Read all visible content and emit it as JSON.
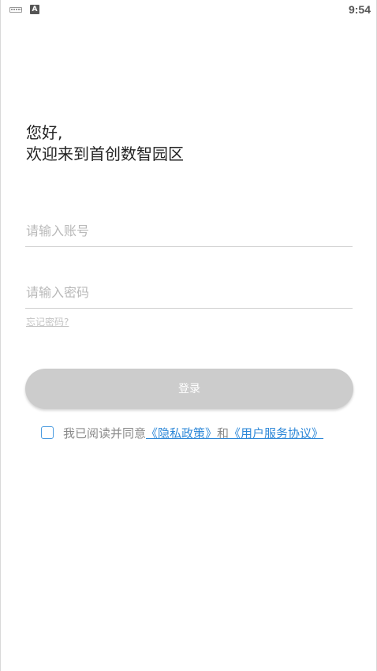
{
  "status_bar": {
    "time": "9:54",
    "a_icon_letter": "A",
    "icons": [
      "keyboard-icon",
      "a-notification-icon"
    ]
  },
  "greeting": {
    "line1": "您好,",
    "line2": "欢迎来到首创数智园区"
  },
  "form": {
    "account_placeholder": "请输入账号",
    "account_value": "",
    "password_placeholder": "请输入密码",
    "password_value": "",
    "forgot_label": "忘记密码?",
    "login_label": "登录"
  },
  "agreement": {
    "checked": false,
    "prefix": "我已阅读并同意",
    "privacy_link": "《隐私政策》",
    "and": "和",
    "terms_link": "《用户服务协议》"
  },
  "colors": {
    "link": "#2e88d8",
    "button_disabled": "#cccccc",
    "checkbox_border": "#4a9be0"
  }
}
